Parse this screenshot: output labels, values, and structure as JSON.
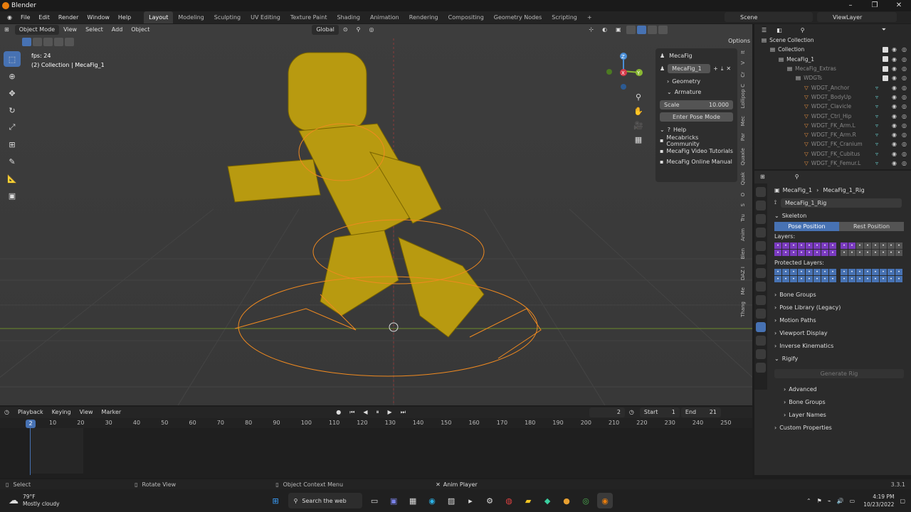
{
  "window": {
    "title": "Blender",
    "controls": [
      "–",
      "❐",
      "✕"
    ]
  },
  "menubar": {
    "items": [
      "File",
      "Edit",
      "Render",
      "Window",
      "Help"
    ],
    "workspaces": [
      "Layout",
      "Modeling",
      "Sculpting",
      "UV Editing",
      "Texture Paint",
      "Shading",
      "Animation",
      "Rendering",
      "Compositing",
      "Geometry Nodes",
      "Scripting"
    ],
    "active_workspace": "Layout",
    "add_workspace": "+",
    "scene": "Scene",
    "view_layer": "ViewLayer"
  },
  "viewport": {
    "mode": "Object Mode",
    "menus": [
      "View",
      "Select",
      "Add",
      "Object"
    ],
    "transform": "Global",
    "options": "Options",
    "fps": "fps: 24",
    "collection": "(2) Collection | MecaFig_1"
  },
  "gizmo": {
    "x": "X",
    "y": "Y",
    "z": "Z"
  },
  "npanel": {
    "title": "MecaFig",
    "object": "MecaFig_1",
    "geometry": "Geometry",
    "armature": "Armature",
    "scale_label": "Scale",
    "scale_value": "10.000",
    "enter_pose": "Enter Pose Mode",
    "help": "Help",
    "links": [
      "Mecabricks Community",
      "MecaFig Video Tutorials",
      "MecaFig Online Manual"
    ]
  },
  "ntabs": [
    "It",
    "V",
    "Cr",
    "Lollipop C",
    "Mec",
    "Par",
    "Quaxle",
    "Quak",
    "O",
    "S",
    "Tru",
    "Anim",
    "Blen",
    "DAZ I",
    "Me",
    "Thang"
  ],
  "outliner": {
    "rows": [
      {
        "label": "Scene Collection",
        "indent": 0,
        "dim": false
      },
      {
        "label": "Collection",
        "indent": 1,
        "dim": false
      },
      {
        "label": "MecaFig_1",
        "indent": 2,
        "dim": false
      },
      {
        "label": "MecaFig_Extras",
        "indent": 3,
        "dim": true
      },
      {
        "label": "WDGTs",
        "indent": 4,
        "dim": true
      },
      {
        "label": "WDGT_Anchor",
        "indent": 5,
        "dim": true
      },
      {
        "label": "WDGT_BodyUp",
        "indent": 5,
        "dim": true
      },
      {
        "label": "WDGT_Clavicle",
        "indent": 5,
        "dim": true
      },
      {
        "label": "WDGT_Ctrl_Hip",
        "indent": 5,
        "dim": true
      },
      {
        "label": "WDGT_FK_Arm.L",
        "indent": 5,
        "dim": true
      },
      {
        "label": "WDGT_FK_Arm.R",
        "indent": 5,
        "dim": true
      },
      {
        "label": "WDGT_FK_Cranium",
        "indent": 5,
        "dim": true
      },
      {
        "label": "WDGT_FK_Cubitus",
        "indent": 5,
        "dim": true
      },
      {
        "label": "WDGT_FK_Femur.L",
        "indent": 5,
        "dim": true
      }
    ]
  },
  "properties": {
    "breadcrumb_a": "MecaFig_1",
    "breadcrumb_b": "MecaFig_1_Rig",
    "data_name": "MecaFig_1_Rig",
    "skeleton": "Skeleton",
    "pose_position": "Pose Position",
    "rest_position": "Rest Position",
    "layers": "Layers:",
    "protected_layers": "Protected Layers:",
    "sections": [
      "Bone Groups",
      "Pose Library (Legacy)",
      "Motion Paths",
      "Viewport Display",
      "Inverse Kinematics"
    ],
    "rigify": "Rigify",
    "generate_rig": "Generate Rig",
    "rigify_subs": [
      "Advanced",
      "Bone Groups",
      "Layer Names"
    ],
    "custom_properties": "Custom Properties"
  },
  "timeline": {
    "menus": [
      "Playback",
      "Keying",
      "View",
      "Marker"
    ],
    "current_frame": "2",
    "start_label": "Start",
    "start": "1",
    "end_label": "End",
    "end": "21",
    "ticks": [
      "10",
      "20",
      "30",
      "40",
      "50",
      "60",
      "70",
      "80",
      "90",
      "100",
      "110",
      "120",
      "130",
      "140",
      "150",
      "160",
      "170",
      "180",
      "190",
      "200",
      "210",
      "220",
      "230",
      "240",
      "250"
    ]
  },
  "statusbar": {
    "select": "Select",
    "rotate": "Rotate View",
    "context": "Object Context Menu",
    "player": "Anim Player",
    "version": "3.3.1"
  },
  "taskbar": {
    "temp": "79°F",
    "weather": "Mostly cloudy",
    "search": "Search the web",
    "time": "4:19 PM",
    "date": "10/23/2022"
  }
}
